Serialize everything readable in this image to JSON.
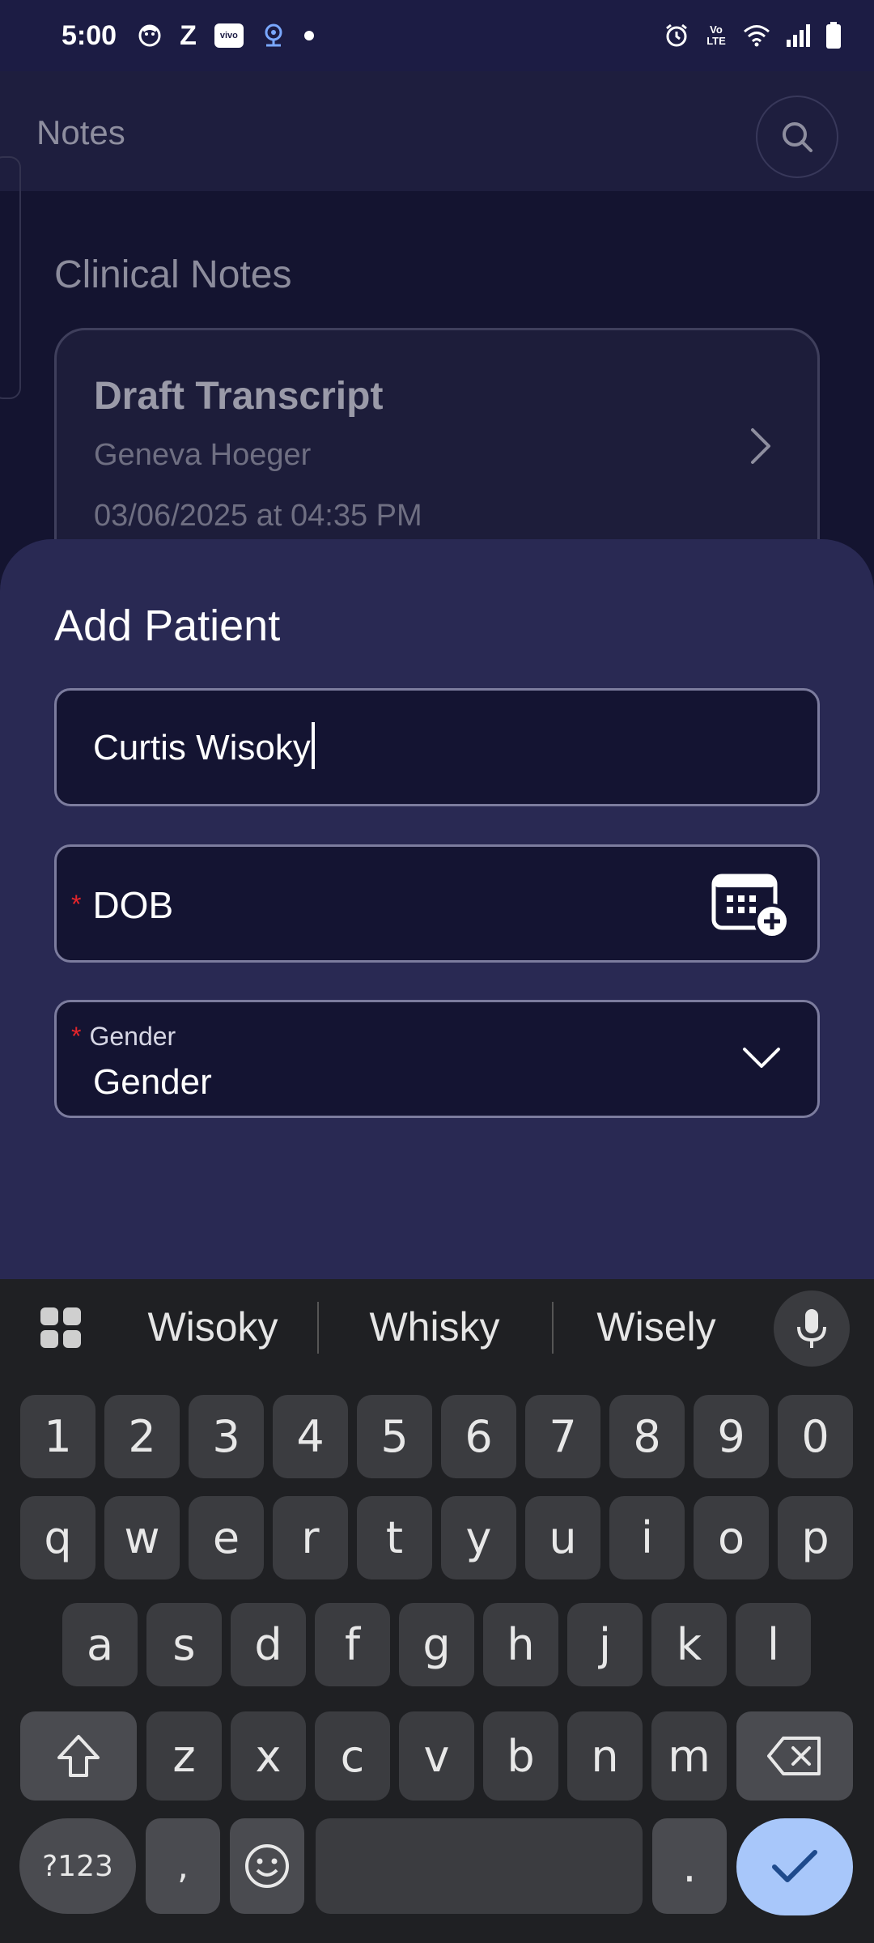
{
  "status_bar": {
    "time": "5:00",
    "left_icons": [
      "face-icon",
      "z-icon",
      "vivo-icon",
      "cam-icon",
      "dot-icon"
    ],
    "right_icons": [
      "alarm-icon",
      "volte-icon",
      "wifi-icon",
      "signal-icon",
      "battery-icon"
    ],
    "z_label": "Z",
    "vivo_label": "vivo",
    "volte_label": "Vo LTE"
  },
  "background_app": {
    "title": "Notes",
    "section_title": "Clinical Notes",
    "card": {
      "title": "Draft Transcript",
      "patient": "Geneva Hoeger",
      "datetime": "03/06/2025 at 04:35 PM"
    }
  },
  "sheet": {
    "title": "Add Patient",
    "name_value": "Curtis Wisoky",
    "dob_required_mark": "*",
    "dob_label": "DOB",
    "gender_required_mark": "*",
    "gender_label": "Gender",
    "gender_value": "Gender"
  },
  "keyboard": {
    "suggestions": [
      "Wisoky",
      "Whisky",
      "Wisely"
    ],
    "row_numbers": [
      "1",
      "2",
      "3",
      "4",
      "5",
      "6",
      "7",
      "8",
      "9",
      "0"
    ],
    "row_q": [
      "q",
      "w",
      "e",
      "r",
      "t",
      "y",
      "u",
      "i",
      "o",
      "p"
    ],
    "row_a": [
      "a",
      "s",
      "d",
      "f",
      "g",
      "h",
      "j",
      "k",
      "l"
    ],
    "row_z": [
      "z",
      "x",
      "c",
      "v",
      "b",
      "n",
      "m"
    ],
    "symbols_label": "?123",
    "comma_label": ",",
    "period_label": "."
  },
  "colors": {
    "accent_enter": "#a8c7fa",
    "required": "#e5252b",
    "sheet_bg": "#292953",
    "field_bg": "#141432"
  }
}
